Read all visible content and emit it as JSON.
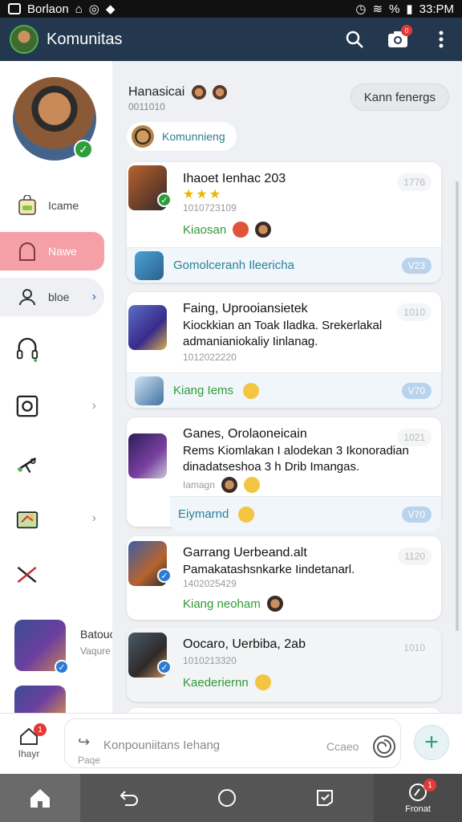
{
  "status_bar": {
    "carrier": "Borlaon",
    "battery": "%",
    "time": "33:PM"
  },
  "app_bar": {
    "title": "Komunitas",
    "camera_badge": "0"
  },
  "sidebar": {
    "items": [
      {
        "label": "Icame"
      },
      {
        "label": "Nawe"
      },
      {
        "label": "bloe"
      }
    ],
    "thumb_text": [
      "Batouc",
      "Vaqure"
    ]
  },
  "header": {
    "name": "Hanasicai",
    "sub": "0011010",
    "join_label": "Kann fenergs",
    "community_label": "Komunnieng"
  },
  "posts": [
    {
      "title": "Ihaoet Ienhac 203",
      "stars": "★★★",
      "meta": "1010723109",
      "time": "1776",
      "green": "Kiaosan",
      "footer": "Gomolceranh Ileericha",
      "count": "V23"
    },
    {
      "title": "Faing, Uprooiansietek",
      "body": "Kiockkian an Toak Iladka. Srekerlakal admanianiokaliy Iinlanag.",
      "meta": "1012022220",
      "time": "1010",
      "footer": "Kiang Iems",
      "count": "V70"
    },
    {
      "title": "Ganes, Orolaoneicain",
      "body": "Rems Kiomlakan I alodekan 3 Ikonoradian dinadatseshoa 3 h Drib Imangas.",
      "meta": "Iamagn",
      "time": "1021",
      "footer": "Eiymarnd",
      "count": "V70"
    },
    {
      "title": "Garrang Uerbeand.alt",
      "body": "Pamakatashsnkarke Iindetanarl.",
      "meta": "1402025429",
      "time": "1120",
      "green": "Kiang neoham"
    },
    {
      "title": "Oocaro, Uerbiba, 2ab",
      "meta": "1010213320",
      "time": "1010",
      "green": "Kaederiernn"
    }
  ],
  "composer": {
    "home_label": "Ihayr",
    "home_badge": "1",
    "placeholder": "Konpouniitans Iehang",
    "sub": "Paqe",
    "action": "Ccaeo"
  },
  "navbar": {
    "profile_label": "Fronat",
    "profile_badge": "1"
  }
}
